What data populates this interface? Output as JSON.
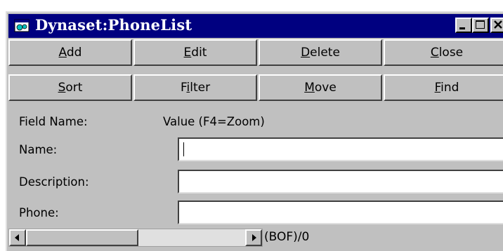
{
  "window": {
    "title": "Dynaset:PhoneList",
    "icon": "dynaset-window-icon",
    "controls": [
      "minimize-icon",
      "maximize-icon",
      "close-icon"
    ]
  },
  "buttons": {
    "row1": [
      {
        "label": "Add",
        "hotkey": "A"
      },
      {
        "label": "Edit",
        "hotkey": "E"
      },
      {
        "label": "Delete",
        "hotkey": "D"
      },
      {
        "label": "Close",
        "hotkey": "C"
      }
    ],
    "row2": [
      {
        "label": "Sort",
        "hotkey": "S"
      },
      {
        "label": "Filter",
        "hotkey": "i"
      },
      {
        "label": "Move",
        "hotkey": "M"
      },
      {
        "label": "Find",
        "hotkey": "F"
      }
    ]
  },
  "header": {
    "field_name": "Field Name:",
    "value": "Value (F4=Zoom)"
  },
  "fields": [
    {
      "label": "Name:",
      "value": ""
    },
    {
      "label": "Description:",
      "value": ""
    },
    {
      "label": "Phone:",
      "value": ""
    }
  ],
  "navigation": {
    "status": "(BOF)/0"
  },
  "colors": {
    "titlebar": "#000080",
    "face": "#c0c0c0"
  }
}
